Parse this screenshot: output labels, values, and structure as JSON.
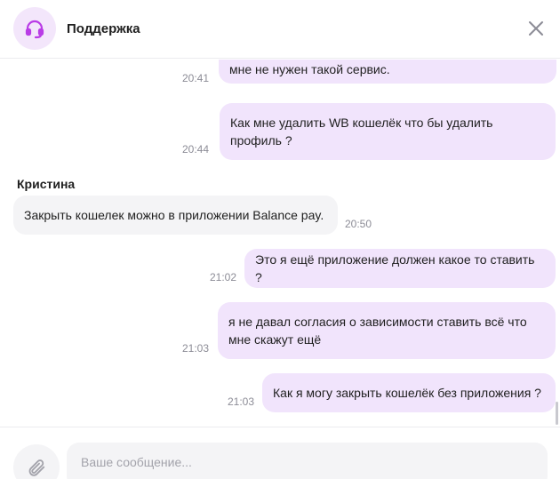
{
  "header": {
    "title": "Поддержка"
  },
  "messages": [
    {
      "text": "мне не нужен такой сервис.",
      "time": "20:41"
    },
    {
      "text": "Как мне удалить WB кошелёк что бы удалить профиль ?",
      "time": "20:44"
    },
    {
      "sender": "Кристина",
      "text": "Закрыть кошелек можно в приложении Balance pay.",
      "time": "20:50"
    },
    {
      "text": "Это я ещё приложение должен какое то ставить ?",
      "time": "21:02"
    },
    {
      "text": "я не давал согласия о зависимости ставить всё что мне скажут ещё",
      "time": "21:03"
    },
    {
      "text": "Как я могу закрыть кошелёк без приложения ?",
      "time": "21:03"
    }
  ],
  "composer": {
    "placeholder": "Ваше сообщение..."
  },
  "icons": {
    "avatar": "headset-icon",
    "close": "close-icon",
    "attach": "paperclip-icon"
  },
  "colors": {
    "outgoing_bubble": "#f1e4fc",
    "incoming_bubble": "#f4f4f6",
    "accent": "#b93ce6"
  }
}
